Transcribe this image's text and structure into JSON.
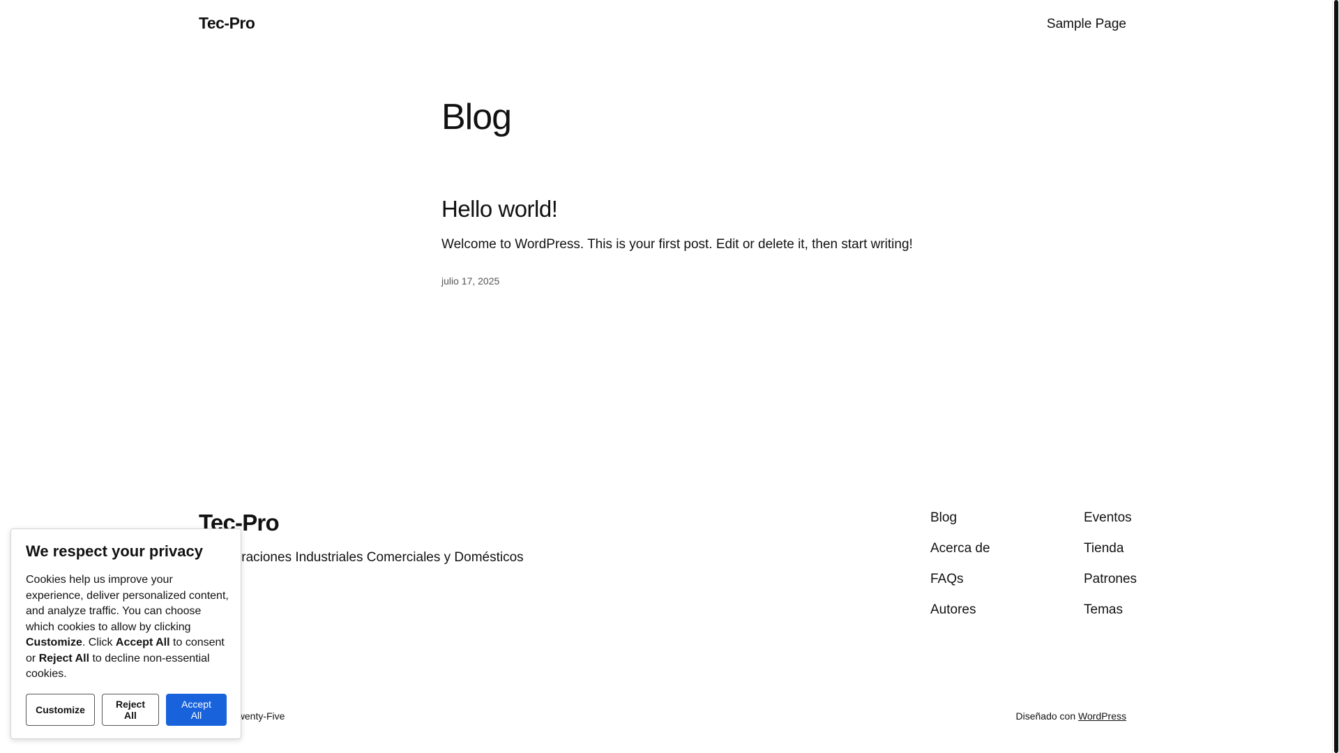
{
  "header": {
    "site_title": "Tec-Pro",
    "nav_link": "Sample Page"
  },
  "main": {
    "heading": "Blog",
    "posts": [
      {
        "title": "Hello world!",
        "excerpt": "Welcome to WordPress. This is your first post. Edit or delete it, then start writing!",
        "date": "julio 17, 2025"
      }
    ]
  },
  "footer": {
    "title": "Tec-Pro",
    "tagline": "Refrigeraciones Industriales Comerciales y Domésticos",
    "col1": [
      "Blog",
      "Acerca de",
      "FAQs",
      "Autores"
    ],
    "col2": [
      "Eventos",
      "Tienda",
      "Patrones",
      "Temas"
    ],
    "credit_left": "Twenty Twenty-Five",
    "credit_right_prefix": "Diseñado con",
    "credit_right_link": "WordPress"
  },
  "cookie_banner": {
    "title": "We respect your privacy",
    "text_1": "Cookies help us improve your experience, deliver personalized content, and analyze traffic. You can choose which cookies to allow by clicking",
    "text_customize": "Customize",
    "text_2": ". Click",
    "text_accept": "Accept All",
    "text_3": "to consent or",
    "text_reject": "Reject All",
    "text_4": "to decline non-essential cookies.",
    "btn_customize": "Customize",
    "btn_reject": "Reject All",
    "btn_accept": "Accept All",
    "accent_color": "#1863dc"
  }
}
